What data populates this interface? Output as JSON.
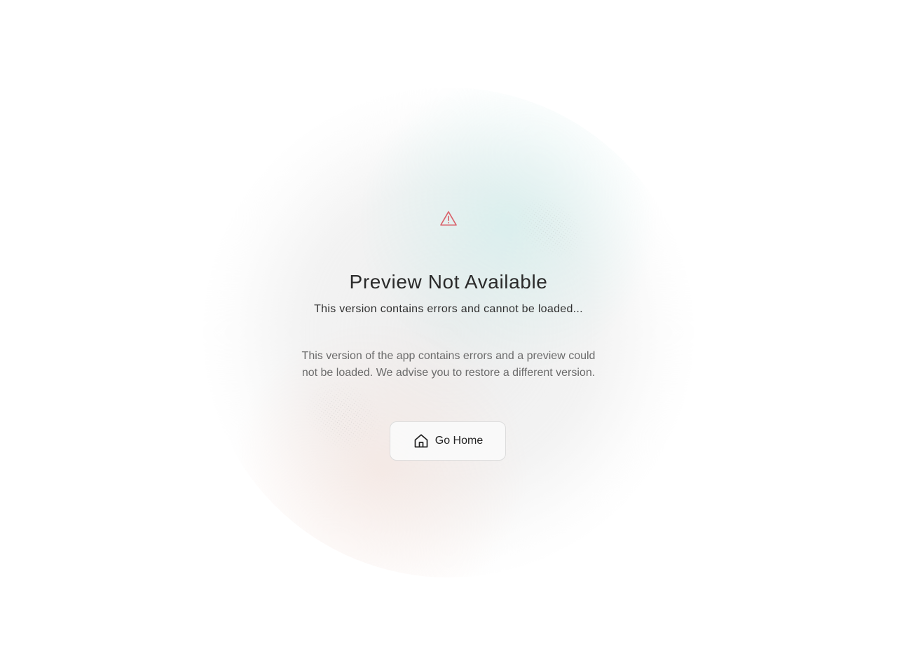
{
  "colors": {
    "warning_icon": "#d9626b",
    "title_text": "#2a2a2a",
    "subtitle_text": "#2f2f2f",
    "description_text": "#6b6b6b",
    "button_border": "#dcdcdc",
    "button_text": "#222222"
  },
  "icons": {
    "warning": "warning-triangle-icon",
    "home": "home-icon"
  },
  "error": {
    "title": "Preview Not Available",
    "subtitle": "This version contains errors and cannot be loaded...",
    "description": "This version of the app contains errors and a preview could not be loaded. We advise you to restore a different version."
  },
  "actions": {
    "home_label": "Go Home"
  }
}
